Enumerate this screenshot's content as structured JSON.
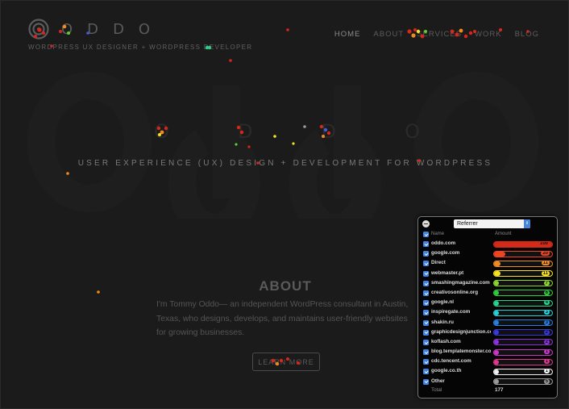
{
  "colors": {
    "background": "#1b1b1b",
    "panel_background": "#050505",
    "checkbox_blue": "#3f82e0"
  },
  "header": {
    "logo_icon": "target-circles-icon",
    "logo_letters": [
      "O",
      "D",
      "D",
      "O"
    ],
    "tagline": "WORDPRESS UX DESIGNER + WORDPRESS DEVELOPER",
    "nav": [
      "HOME",
      "ABOUT",
      "SERVICES",
      "WORK",
      "BLOG"
    ]
  },
  "hero": {
    "letters": [
      "O",
      "D",
      "D",
      "O"
    ],
    "subtitle": "USER EXPERIENCE (UX) DESIGN + DEVELOPMENT FOR WORDPRESS"
  },
  "about": {
    "title": "ABOUT",
    "text": "I'm Tommy Oddo— an independent WordPress consultant in Austin, Texas, who designs, develops, and maintains user-friendly websites for growing businesses.",
    "button": "LEARN MORE"
  },
  "referrer_panel": {
    "selected_option": "Referrer",
    "column_name": "Name",
    "column_amount": "Amount",
    "rows": [
      {
        "name": "oddo.com",
        "amount": 100,
        "color": "#d42a1a"
      },
      {
        "name": "google.com",
        "amount": 20,
        "color": "#ee4422"
      },
      {
        "name": "Direct",
        "amount": 11,
        "color": "#f38a1f"
      },
      {
        "name": "webmaster.pt",
        "amount": 11,
        "color": "#f5e21c"
      },
      {
        "name": "smashingmagazine.com",
        "amount": 7,
        "color": "#8ad62a"
      },
      {
        "name": "creativosonline.org",
        "amount": 6,
        "color": "#2ccf3c"
      },
      {
        "name": "google.nl",
        "amount": 4,
        "color": "#29d38f"
      },
      {
        "name": "inspiregate.com",
        "amount": 3,
        "color": "#2bcfd6"
      },
      {
        "name": "shakin.ru",
        "amount": 3,
        "color": "#2a7ee0"
      },
      {
        "name": "graphicdesignjunction.com",
        "amount": 2,
        "color": "#3a3ad8"
      },
      {
        "name": "koflash.com",
        "amount": 2,
        "color": "#8a34d6"
      },
      {
        "name": "blog.templatemonster.com",
        "amount": 1,
        "color": "#c935c8"
      },
      {
        "name": "cdc.tencent.com",
        "amount": 1,
        "color": "#e03590"
      },
      {
        "name": "google.co.th",
        "amount": 1,
        "color": "#f2f2f2"
      },
      {
        "name": "Other",
        "amount": 5,
        "color": "#9a9a9a"
      }
    ],
    "total_label": "Total",
    "total_value": "177"
  }
}
